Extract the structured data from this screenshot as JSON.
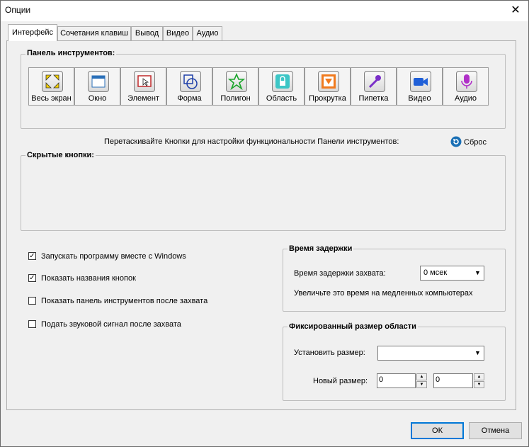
{
  "window": {
    "title": "Опции",
    "close_glyph": "✕"
  },
  "tabs": [
    {
      "label": "Интерфейс",
      "active": true
    },
    {
      "label": "Сочетания клавиш",
      "active": false
    },
    {
      "label": "Вывод",
      "active": false
    },
    {
      "label": "Видео",
      "active": false
    },
    {
      "label": "Аудио",
      "active": false
    }
  ],
  "toolbar_panel": {
    "title": "Панель инструментов:",
    "buttons": [
      {
        "label": "Весь экран",
        "icon": "fullscreen-icon"
      },
      {
        "label": "Окно",
        "icon": "window-icon"
      },
      {
        "label": "Элемент",
        "icon": "element-icon"
      },
      {
        "label": "Форма",
        "icon": "shape-icon"
      },
      {
        "label": "Полигон",
        "icon": "polygon-icon"
      },
      {
        "label": "Область",
        "icon": "region-icon"
      },
      {
        "label": "Прокрутка",
        "icon": "scroll-icon"
      },
      {
        "label": "Пипетка",
        "icon": "eyedropper-icon"
      },
      {
        "label": "Видео",
        "icon": "video-camera-icon"
      },
      {
        "label": "Аудио",
        "icon": "microphone-icon"
      }
    ]
  },
  "drag_hint": "Перетаскивайте Кнопки для настройки функциональности Панели инструментов:",
  "reset": {
    "label": "Сброс",
    "icon": "reset-icon"
  },
  "hidden_buttons": {
    "title": "Скрытые кнопки:"
  },
  "checkboxes": [
    {
      "label": "Запускать программу вместе с Windows",
      "checked": true
    },
    {
      "label": "Показать названия кнопок",
      "checked": true
    },
    {
      "label": "Показать панель инструментов после захвата",
      "checked": false
    },
    {
      "label": "Подать звуковой сигнал после захвата",
      "checked": false
    }
  ],
  "delay": {
    "title": "Время задержки",
    "label": "Время задержки захвата:",
    "value": "0 мсек",
    "hint": "Увеличьте это время на медленных компьютерах"
  },
  "fixed_size": {
    "title": "Фиксированный размер области",
    "set_label": "Установить размер:",
    "set_value": "",
    "new_label": "Новый размер:",
    "width_value": "0",
    "height_value": "0"
  },
  "footer": {
    "ok_label": "ОК",
    "cancel_label": "Отмена"
  },
  "colors": {
    "default_button_border": "#0078d7",
    "checkmark": "#000000"
  }
}
